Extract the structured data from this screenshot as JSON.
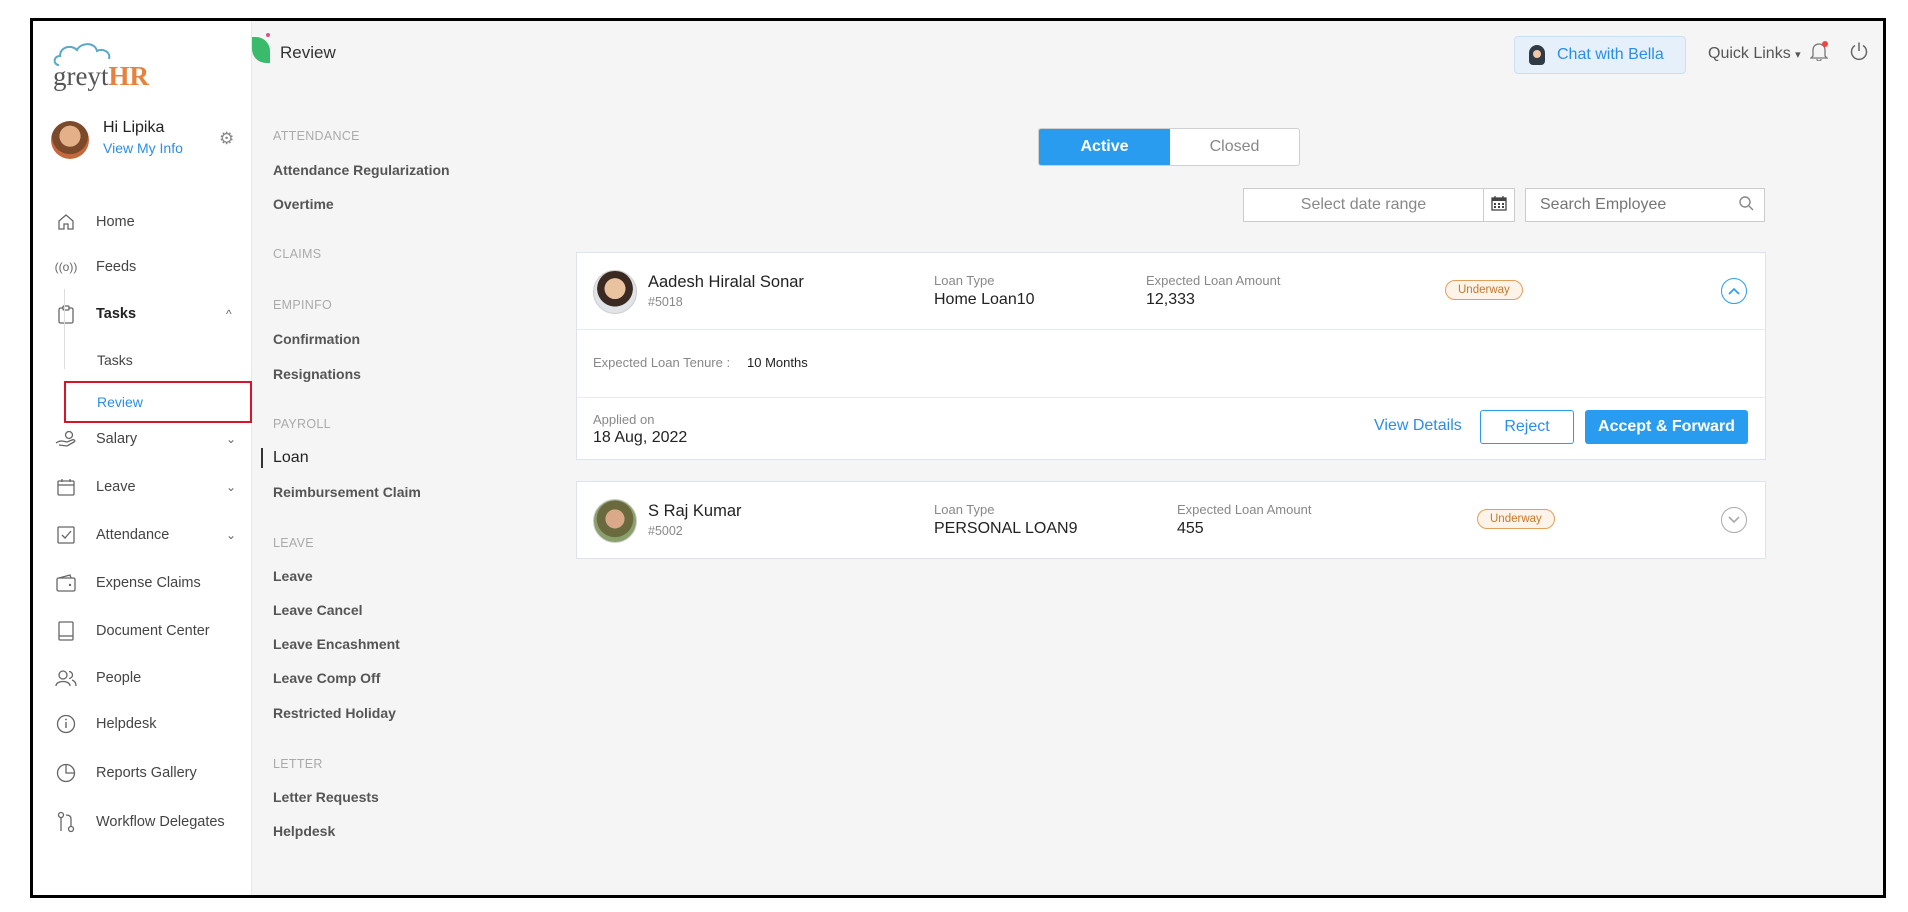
{
  "logo": {
    "text_grey": "greyt",
    "text_hr": "HR"
  },
  "user": {
    "greeting": "Hi Lipika",
    "view_link": "View My Info"
  },
  "sidebar": {
    "items": [
      {
        "label": "Home",
        "icon": "home-icon"
      },
      {
        "label": "Feeds",
        "icon": "feeds-icon"
      },
      {
        "label": "Tasks",
        "icon": "clipboard-icon"
      },
      {
        "label": "Salary",
        "icon": "salary-icon"
      },
      {
        "label": "Leave",
        "icon": "calendar-icon"
      },
      {
        "label": "Attendance",
        "icon": "attendance-icon"
      },
      {
        "label": "Expense Claims",
        "icon": "wallet-icon"
      },
      {
        "label": "Document Center",
        "icon": "book-icon"
      },
      {
        "label": "People",
        "icon": "people-icon"
      },
      {
        "label": "Helpdesk",
        "icon": "info-icon"
      },
      {
        "label": "Reports Gallery",
        "icon": "pie-chart-icon"
      },
      {
        "label": "Workflow Delegates",
        "icon": "workflow-icon"
      }
    ],
    "tasks_sub": [
      {
        "label": "Tasks"
      },
      {
        "label": "Review"
      }
    ]
  },
  "header": {
    "title": "Review",
    "chat_label": "Chat with Bella",
    "quick_links": "Quick Links"
  },
  "categories": {
    "attendance_head": "ATTENDANCE",
    "attendance_items": [
      "Attendance Regularization",
      "Overtime"
    ],
    "claims_head": "CLAIMS",
    "empinfo_head": "EMPINFO",
    "empinfo_items": [
      "Confirmation",
      "Resignations"
    ],
    "payroll_head": "PAYROLL",
    "payroll_items": [
      "Loan",
      "Reimbursement Claim"
    ],
    "leave_head": "LEAVE",
    "leave_items": [
      "Leave",
      "Leave Cancel",
      "Leave Encashment",
      "Leave Comp Off",
      "Restricted Holiday"
    ],
    "letter_head": "LETTER",
    "letter_items": [
      "Letter Requests",
      "Helpdesk"
    ]
  },
  "toggle": {
    "active": "Active",
    "closed": "Closed"
  },
  "filters": {
    "date_placeholder": "Select date range",
    "search_placeholder": "Search Employee"
  },
  "requests": [
    {
      "name": "Aadesh Hiralal Sonar",
      "id": "#5018",
      "loan_type_label": "Loan Type",
      "loan_type": "Home Loan10",
      "amount_label": "Expected Loan Amount",
      "amount": "12,333",
      "status": "Underway",
      "tenure_label": "Expected Loan Tenure :",
      "tenure": "10 Months",
      "applied_label": "Applied on",
      "applied": "18 Aug, 2022",
      "view_details": "View Details",
      "reject": "Reject",
      "accept": "Accept & Forward"
    },
    {
      "name": "S Raj Kumar",
      "id": "#5002",
      "loan_type_label": "Loan Type",
      "loan_type": "PERSONAL LOAN9",
      "amount_label": "Expected Loan Amount",
      "amount": "455",
      "status": "Underway"
    }
  ]
}
